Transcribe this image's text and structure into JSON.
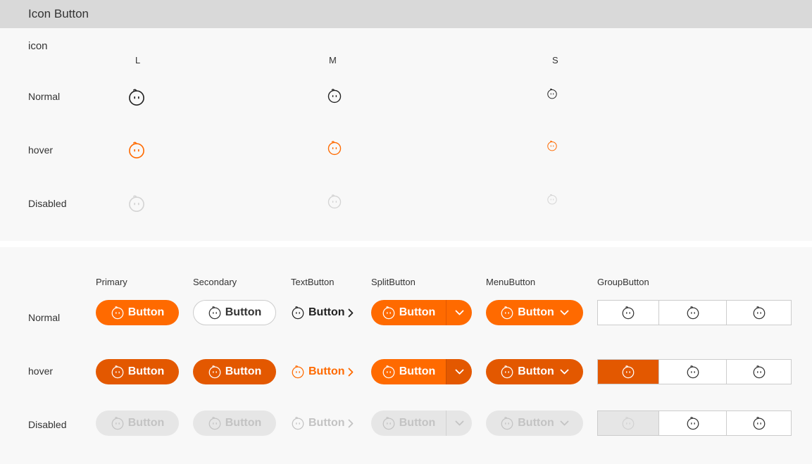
{
  "header": {
    "title": "Icon Button"
  },
  "icon_section": {
    "title": "icon",
    "sizes": [
      "L",
      "M",
      "S"
    ],
    "rows": [
      "Normal",
      "hover",
      "Disabled"
    ]
  },
  "button_section": {
    "columns": [
      "Primary",
      "Secondary",
      "TextButton",
      "SplitButton",
      "MenuButton",
      "GroupButton"
    ],
    "rows": [
      "Normal",
      "hover",
      "Disabled"
    ],
    "button_label": "Button"
  },
  "colors": {
    "accent": "#ff6a00",
    "accent_hover": "#e35800",
    "disabled_bg": "#e6e6e6",
    "disabled_text": "#c3c3c3",
    "border": "#cccccc",
    "header_bg": "#d9d9d9",
    "panel_bg": "#f8f8f8"
  },
  "icons": {
    "face": "face-icon",
    "chevron_right": "chevron-right-icon",
    "chevron_down": "chevron-down-icon"
  }
}
